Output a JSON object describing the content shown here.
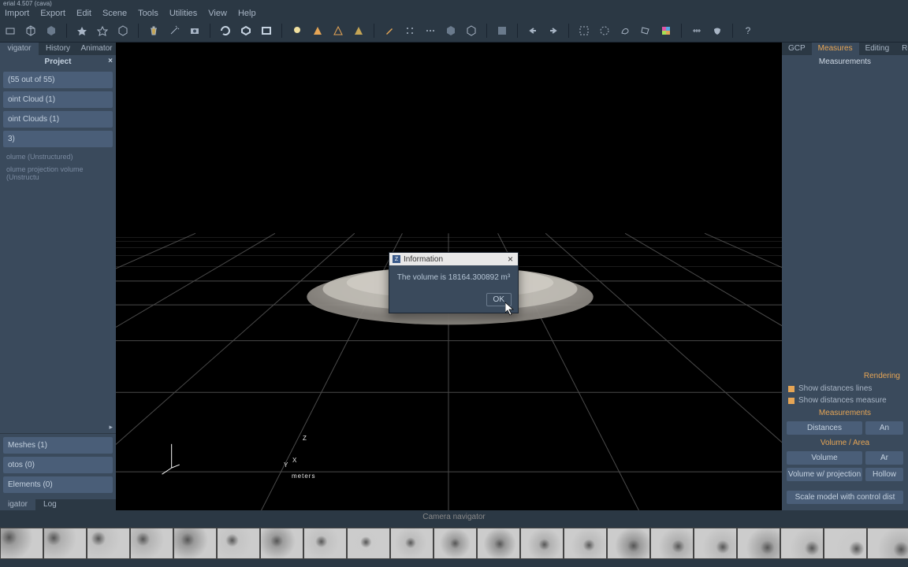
{
  "title_bar": "erial 4.507 (cava)",
  "menus": [
    "Import",
    "Export",
    "Edit",
    "Scene",
    "Tools",
    "Utilities",
    "View",
    "Help"
  ],
  "left_tabs": [
    "vigator",
    "History",
    "Animator"
  ],
  "left_active_tab": 0,
  "project_header": "Project",
  "tree_items": [
    "(55 out of 55)",
    "oint Cloud (1)",
    "oint Clouds (1)",
    "3)"
  ],
  "tree_subs": [
    "olume (Unstructured)",
    "olume projection volume (Unstructu"
  ],
  "tree2_items": [
    "Meshes (1)",
    "otos (0)",
    "Elements (0)"
  ],
  "bottom_tabs": [
    "igator",
    "Log"
  ],
  "bottom_active_tab": 0,
  "right_tabs": [
    "GCP",
    "Measures",
    "Editing",
    "Reg"
  ],
  "right_active_tab": 1,
  "right": {
    "measurements_header": "Measurements",
    "rendering_header": "Rendering",
    "chk_lines": "Show distances lines",
    "chk_measure": "Show distances measure",
    "measurements2_header": "Measurements",
    "distances_btn": "Distances",
    "an_btn": "An",
    "volarea_header": "Volume / Area",
    "volume_btn": "Volume",
    "ar_btn": "Ar",
    "volproj_btn": "Volume w/ projection",
    "hollow_btn": "Hollow",
    "scale_btn": "Scale model with control dist"
  },
  "camera_nav": "Camera navigator",
  "dialog": {
    "title": "Information",
    "message": "The volume is 18164.300892 m³",
    "ok": "OK"
  },
  "axis": {
    "z": "Z",
    "x": "X",
    "y": "Y",
    "unit": "meters"
  },
  "thumb_count": 21,
  "colors": {
    "accent": "#e6a555",
    "panel": "#3a4a5c",
    "item": "#4a5e78"
  }
}
